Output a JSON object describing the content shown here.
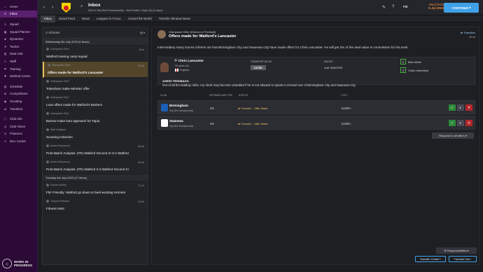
{
  "sidebar": {
    "items": [
      {
        "label": "Home",
        "icon": "home-icon"
      },
      {
        "label": "Inbox",
        "icon": "inbox-icon",
        "active": true
      },
      {
        "label": "Squad",
        "icon": "shirt-icon"
      },
      {
        "label": "Squad Planner",
        "icon": "planner-icon"
      },
      {
        "label": "Dynamics",
        "icon": "dynamics-icon"
      },
      {
        "label": "Tactics",
        "icon": "tactics-icon"
      },
      {
        "label": "Data Hub",
        "icon": "data-icon"
      },
      {
        "label": "Staff",
        "icon": "staff-icon"
      },
      {
        "label": "Training",
        "icon": "training-icon"
      },
      {
        "label": "Medical Centre",
        "icon": "medical-icon"
      },
      {
        "label": "Schedule",
        "icon": "calendar-icon"
      },
      {
        "label": "Competitions",
        "icon": "trophy-icon"
      },
      {
        "label": "Scouting",
        "icon": "scouting-icon"
      },
      {
        "label": "Transfers",
        "icon": "transfers-icon"
      },
      {
        "label": "Club Info",
        "icon": "info-icon"
      },
      {
        "label": "Club Vision",
        "icon": "vision-icon"
      },
      {
        "label": "Finances",
        "icon": "finances-icon"
      },
      {
        "label": "Dev. Centre",
        "icon": "dev-icon"
      }
    ],
    "wip_line1": "WORK IN",
    "wip_line2": "PROGRESS"
  },
  "topbar": {
    "title": "Inbox",
    "subtitle": "23rd in Sky Bet Championship - Next Match: Clyde (A) (3 days)",
    "date_day": "Wed 09:00",
    "date_val": "5 Jul 2023",
    "continue_label": "CONTINUE",
    "fm_label": "FM"
  },
  "tabs": [
    "Inbox",
    "Social Feed",
    "News",
    "Leagues in Focus",
    "Around the World",
    "Transfer Window News"
  ],
  "inbox": {
    "filter_label": "All Items",
    "groups": [
      {
        "date": "Wednesday 5th July 2023 (6 items)",
        "messages": [
          {
            "from": "Giampaolo Olive",
            "subject": "Watford training camp squad",
            "time": "Now",
            "selected": false
          },
          {
            "from": "Giampaolo Olive",
            "subject": "Offers made for Watford's Lancaster",
            "time": "08:46",
            "selected": true
          },
          {
            "from": "Giampaolo Olive",
            "subject": "Tottenham make Méndez offer",
            "time": "",
            "selected": false
          },
          {
            "from": "Giampaolo Olive",
            "subject": "Loan offers made for Watford's Barbero",
            "time": "",
            "selected": false
          },
          {
            "from": "Giampaolo Olive",
            "subject": "Barrow make loan approach for Tapia",
            "time": "",
            "selected": false
          },
          {
            "from": "Matt Hodgson",
            "subject": "Scouting Induction",
            "time": "",
            "selected": false
          },
          {
            "from": "Adrian Beaumont",
            "subject": "Post-Match Analysis: (FR) Watford Second XI 3-2 Watford",
            "time": "08:46",
            "selected": false
          },
          {
            "from": "Adrian Beaumont",
            "subject": "Post-Match Analysis: (FR) Watford 2-3 Watford Second XI",
            "time": "08:46",
            "selected": false
          }
        ]
      },
      {
        "date": "Tuesday 4th July 2023 (17 items)",
        "messages": [
          {
            "from": "Sophie Ashley",
            "subject": "FM: Friendly: Watford go down to hard-working Hornets",
            "time": "21:43",
            "selected": false
          },
          {
            "from": "Joaquin Palacios",
            "subject": "Fitness tests",
            "time": "20:00",
            "selected": false
          }
        ]
      }
    ]
  },
  "detail": {
    "from": "Giampaolo Olive (Director of Football)",
    "subject": "Offers made for Watford's Lancaster",
    "badge": "Transfers",
    "time": "08:46",
    "body": "Intermediary Harry Dunne informs me that Birmingham City and Swansea City have made offers for Chris Lancaster. He will get 2% of the deal value in commission for his work.",
    "player": {
      "name": "Chris Lancaster",
      "age": "20 years old",
      "nation": "England",
      "transfer_value_label": "TRANSFER VALUE",
      "transfer_value": "£375K",
      "wages_label": "WAGES",
      "wages": "until 30/6/2025",
      "bids_made_count": "2",
      "bids_made_label": "Bids Made",
      "clubs_interested_count": "3",
      "clubs_interested_label": "Clubs Interested"
    },
    "agent_title": "AGENT FEEDBACK:",
    "agent_text": "Out of all the bidding clubs, my client may become unsettled if he is not allowed to speak to at least one of Birmingham City and Swansea City.",
    "table_headers": {
      "club": "CLUB",
      "fee": "INTERMEDIARY FEE",
      "status": "STATUS",
      "cost": "COST"
    },
    "offers": [
      {
        "club": "Birmingham",
        "league": "Sky Bet Championship",
        "fee": "2%",
        "status": "Transfer - Offer Made",
        "cost": "£240K"
      },
      {
        "club": "Swansea",
        "league": "Sky Bet Championship",
        "fee": "2%",
        "status": "Transfer - Offer Made",
        "cost": "£240K"
      }
    ],
    "respond_label": "Respond to all offers",
    "responsibilities_label": "Responsibilities",
    "transfer_centre_label": "Transfer Centre",
    "transfer_info_label": "Transfer Info"
  },
  "colors": {
    "sidebar": "#2b0a36",
    "accent": "#3fa1e8",
    "selected": "#52452a",
    "status": "#e7c15c"
  }
}
